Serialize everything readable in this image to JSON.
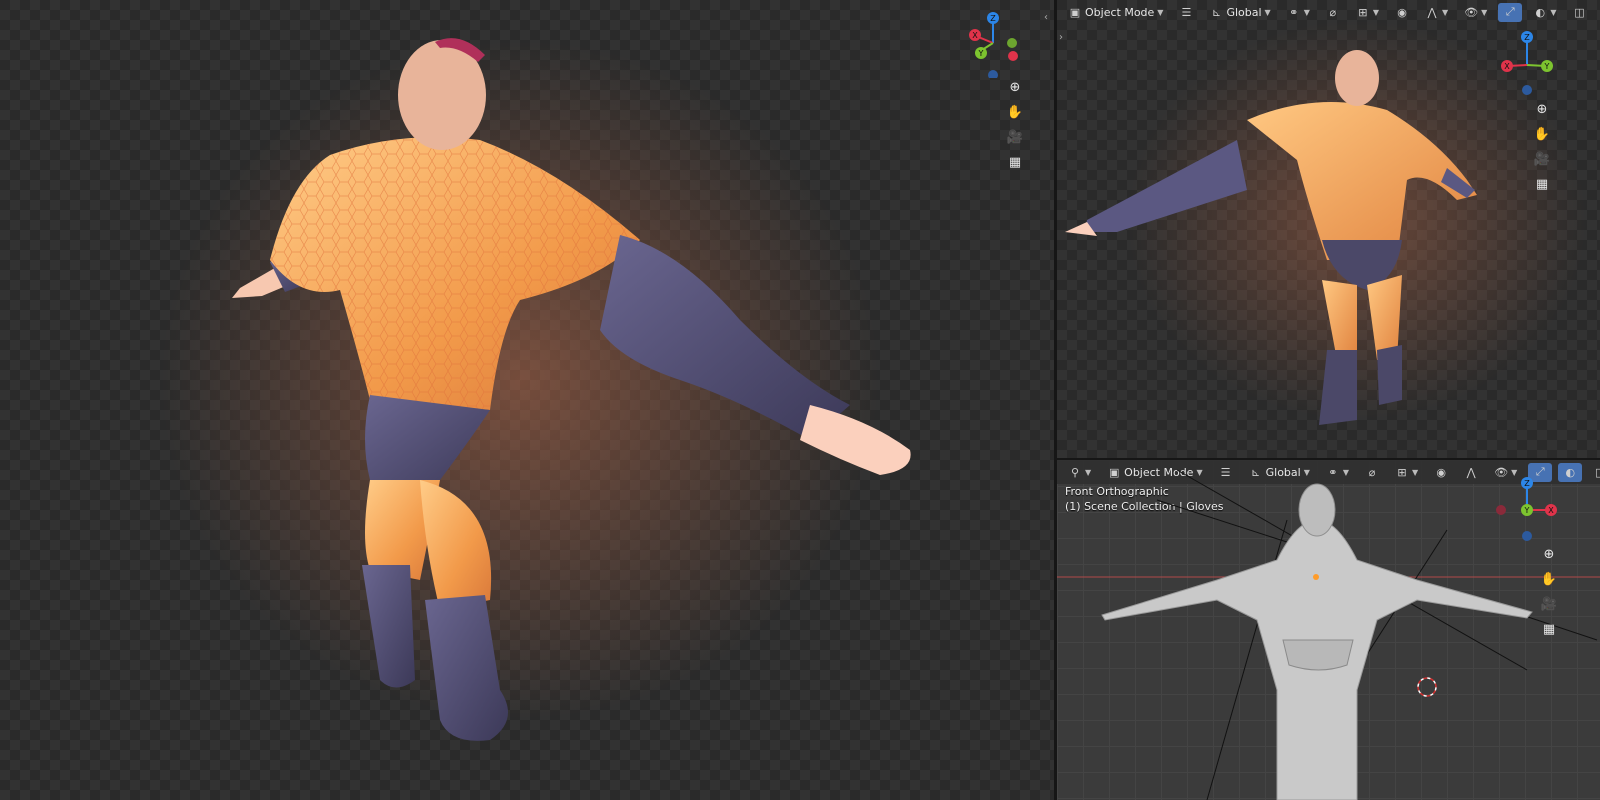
{
  "left_view": {
    "side_toggle": "‹"
  },
  "top_right": {
    "mode_label": "Object Mode",
    "orientation_label": "Global",
    "side_toggle": "›"
  },
  "bottom_right": {
    "mode_label": "Object Mode",
    "orientation_label": "Global",
    "view_name": "Front Orthographic",
    "collection_info": "(1) Scene Collection | Gloves"
  },
  "gizmo_axes": {
    "x": "X",
    "y": "Y",
    "z": "Z"
  },
  "colors": {
    "x_axis": "#e0334a",
    "y_axis": "#7dc42f",
    "z_axis": "#2c86e8",
    "active_button": "#4772b3",
    "skin_suit": "#f2a04e",
    "dark_fabric": "#4b4868"
  },
  "icons": [
    "zoom-icon",
    "hand-pan-icon",
    "camera-icon",
    "grid-icon",
    "menu-icon",
    "snap-icon",
    "proportional-icon",
    "overlay-icon",
    "shading-icon"
  ]
}
